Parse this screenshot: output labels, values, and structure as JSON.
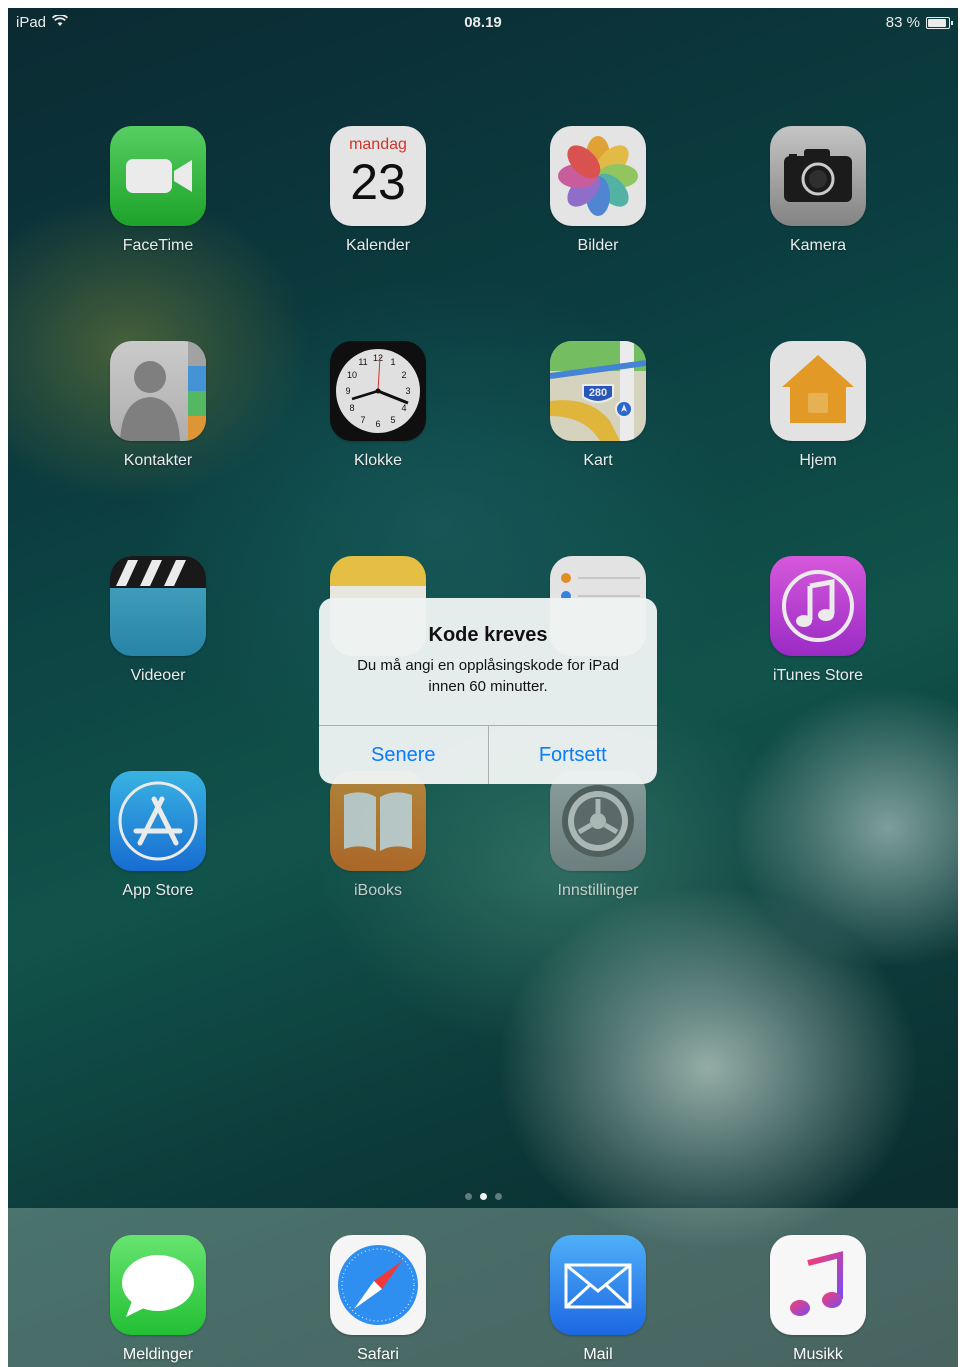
{
  "status": {
    "device": "iPad",
    "time": "08.19",
    "battery": "83 %",
    "battery_level": 0.83
  },
  "apps": [
    {
      "name": "FaceTime",
      "icon": "facetime-icon"
    },
    {
      "name": "Kalender",
      "icon": "calendar-icon",
      "weekday": "mandag",
      "day": "23"
    },
    {
      "name": "Bilder",
      "icon": "photos-icon"
    },
    {
      "name": "Kamera",
      "icon": "camera-icon"
    },
    {
      "name": "Kontakter",
      "icon": "contacts-icon"
    },
    {
      "name": "Klokke",
      "icon": "clock-icon"
    },
    {
      "name": "Kart",
      "icon": "maps-icon",
      "shield": "280"
    },
    {
      "name": "Hjem",
      "icon": "home-icon"
    },
    {
      "name": "Videoer",
      "icon": "videos-icon"
    },
    {
      "name": "",
      "icon": "notes-icon"
    },
    {
      "name": "",
      "icon": "reminders-icon"
    },
    {
      "name": "iTunes Store",
      "icon": "itunes-store-icon"
    },
    {
      "name": "App Store",
      "icon": "app-store-icon"
    },
    {
      "name": "iBooks",
      "icon": "ibooks-icon"
    },
    {
      "name": "Innstillinger",
      "icon": "settings-icon"
    }
  ],
  "dock": [
    {
      "name": "Meldinger",
      "icon": "messages-icon"
    },
    {
      "name": "Safari",
      "icon": "safari-icon"
    },
    {
      "name": "Mail",
      "icon": "mail-icon"
    },
    {
      "name": "Musikk",
      "icon": "music-icon"
    }
  ],
  "alert": {
    "title": "Kode kreves",
    "message": "Du må angi en opplåsingskode for iPad innen 60 minutter.",
    "later": "Senere",
    "continue": "Fortsett"
  },
  "page_indicator": {
    "pages": 3,
    "current": 2
  },
  "colors": {
    "alert_button": "#0a7aff"
  }
}
